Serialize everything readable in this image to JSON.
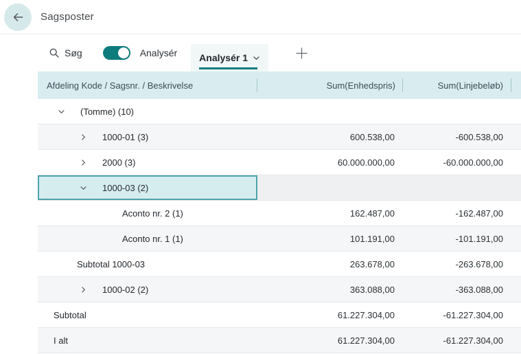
{
  "header": {
    "title": "Sagsposter"
  },
  "toolbar": {
    "search_label": "Søg",
    "analyze_toggle_label": "Analysér",
    "analyze_toggle_on": true,
    "active_tab_label": "Analysér 1"
  },
  "icons": {
    "back": "arrow-left",
    "search": "magnifier",
    "tab_caret": "chevron-down",
    "add_tab": "plus",
    "row_expanded": "chevron-down",
    "row_collapsed": "chevron-right"
  },
  "colors": {
    "accent_teal": "#0e7c7c",
    "table_header_bg": "#d9edf0",
    "selected_cell_bg": "#d6edf0",
    "selected_cell_border": "#4fa3aa",
    "alt_row_bg": "#f5f6f7",
    "back_button_bg": "#d5e9ea"
  },
  "table": {
    "columns": [
      "Afdeling Kode / Sagsnr. / Beskrivelse",
      "Sum(Enhedspris)",
      "Sum(Linjebeløb)"
    ],
    "rows": [
      {
        "label": "(Tomme) (10)",
        "val1": "",
        "val2": "",
        "style": "lvl0",
        "chevron": "down",
        "selected": false
      },
      {
        "label": "1000-01 (3)",
        "val1": "600.538,00",
        "val2": "-600.538,00",
        "style": "lvl1",
        "chevron": "right",
        "selected": false
      },
      {
        "label": "2000 (3)",
        "val1": "60.000.000,00",
        "val2": "-60.000.000,00",
        "style": "lvl1",
        "chevron": "right",
        "selected": false
      },
      {
        "label": "1000-03 (2)",
        "val1": "",
        "val2": "",
        "style": "lvl1",
        "chevron": "down",
        "selected": true
      },
      {
        "label": "Aconto nr. 2 (1)",
        "val1": "162.487,00",
        "val2": "-162.487,00",
        "style": "lvl2",
        "chevron": null,
        "selected": false
      },
      {
        "label": "Aconto nr. 1 (1)",
        "val1": "101.191,00",
        "val2": "-101.191,00",
        "style": "lvl2",
        "chevron": null,
        "selected": false
      },
      {
        "label": "Subtotal 1000-03",
        "val1": "263.678,00",
        "val2": "-263.678,00",
        "style": "sub",
        "chevron": null,
        "selected": false
      },
      {
        "label": "1000-02 (2)",
        "val1": "363.088,00",
        "val2": "-363.088,00",
        "style": "lvl1",
        "chevron": "right",
        "selected": false
      },
      {
        "label": "Subtotal",
        "val1": "61.227.304,00",
        "val2": "-61.227.304,00",
        "style": "grand",
        "chevron": null,
        "selected": false
      },
      {
        "label": "I alt",
        "val1": "61.227.304,00",
        "val2": "-61.227.304,00",
        "style": "grand",
        "chevron": null,
        "selected": false
      }
    ]
  }
}
